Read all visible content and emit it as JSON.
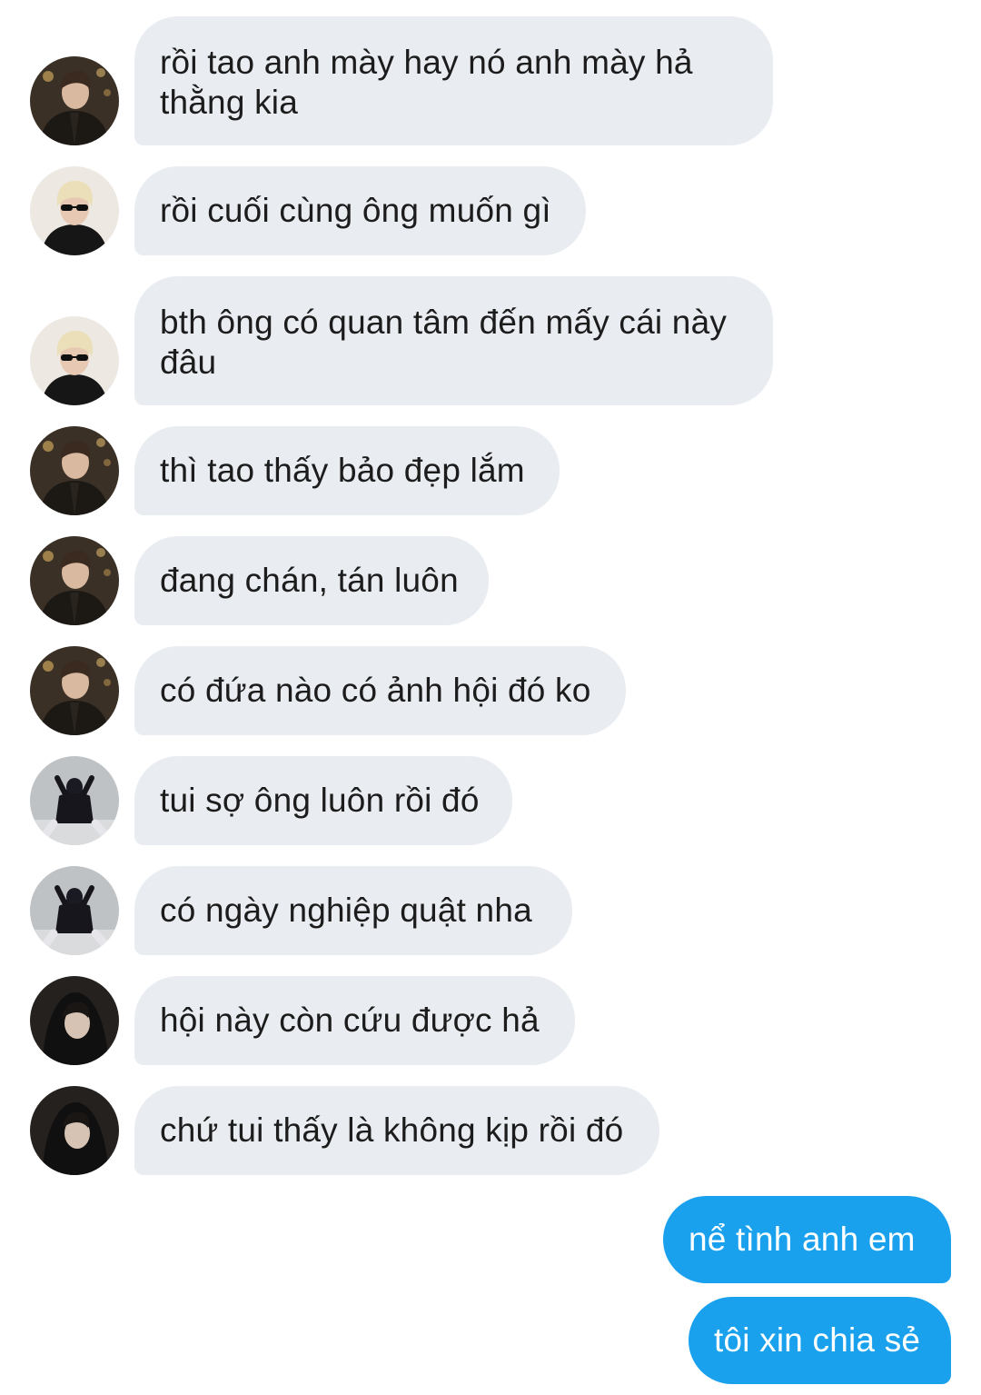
{
  "conversation": {
    "messages": [
      {
        "direction": "incoming",
        "avatar": "avatar-leather-jacket",
        "text": "rồi tao anh mày hay nó anh mày hả thằng kia"
      },
      {
        "direction": "incoming",
        "avatar": "avatar-blonde-sunglasses",
        "text": "rồi cuối cùng ông muốn gì"
      },
      {
        "direction": "incoming",
        "avatar": "avatar-blonde-sunglasses",
        "text": "bth ông có quan tâm đến mấy cái này đâu"
      },
      {
        "direction": "incoming",
        "avatar": "avatar-leather-jacket",
        "text": "thì tao thấy bảo đẹp lắm"
      },
      {
        "direction": "incoming",
        "avatar": "avatar-leather-jacket",
        "text": "đang chán, tán luôn"
      },
      {
        "direction": "incoming",
        "avatar": "avatar-leather-jacket",
        "text": "có đứa nào có ảnh hội đó ko"
      },
      {
        "direction": "incoming",
        "avatar": "avatar-dancer-pose",
        "text": "tui sợ ông luôn rồi đó"
      },
      {
        "direction": "incoming",
        "avatar": "avatar-dancer-pose",
        "text": "có ngày nghiệp quật nha"
      },
      {
        "direction": "incoming",
        "avatar": "avatar-dark-hoodie",
        "text": "hội này còn cứu được hả"
      },
      {
        "direction": "incoming",
        "avatar": "avatar-dark-hoodie",
        "text": "chứ tui thấy là không kịp rồi đó"
      },
      {
        "direction": "outgoing",
        "text": "nể tình anh em"
      },
      {
        "direction": "outgoing",
        "text": "tôi xin chia sẻ"
      }
    ]
  },
  "colors": {
    "incoming_bubble": "#e9ecf1",
    "outgoing_bubble": "#1aa1ee",
    "background": "#ffffff"
  }
}
